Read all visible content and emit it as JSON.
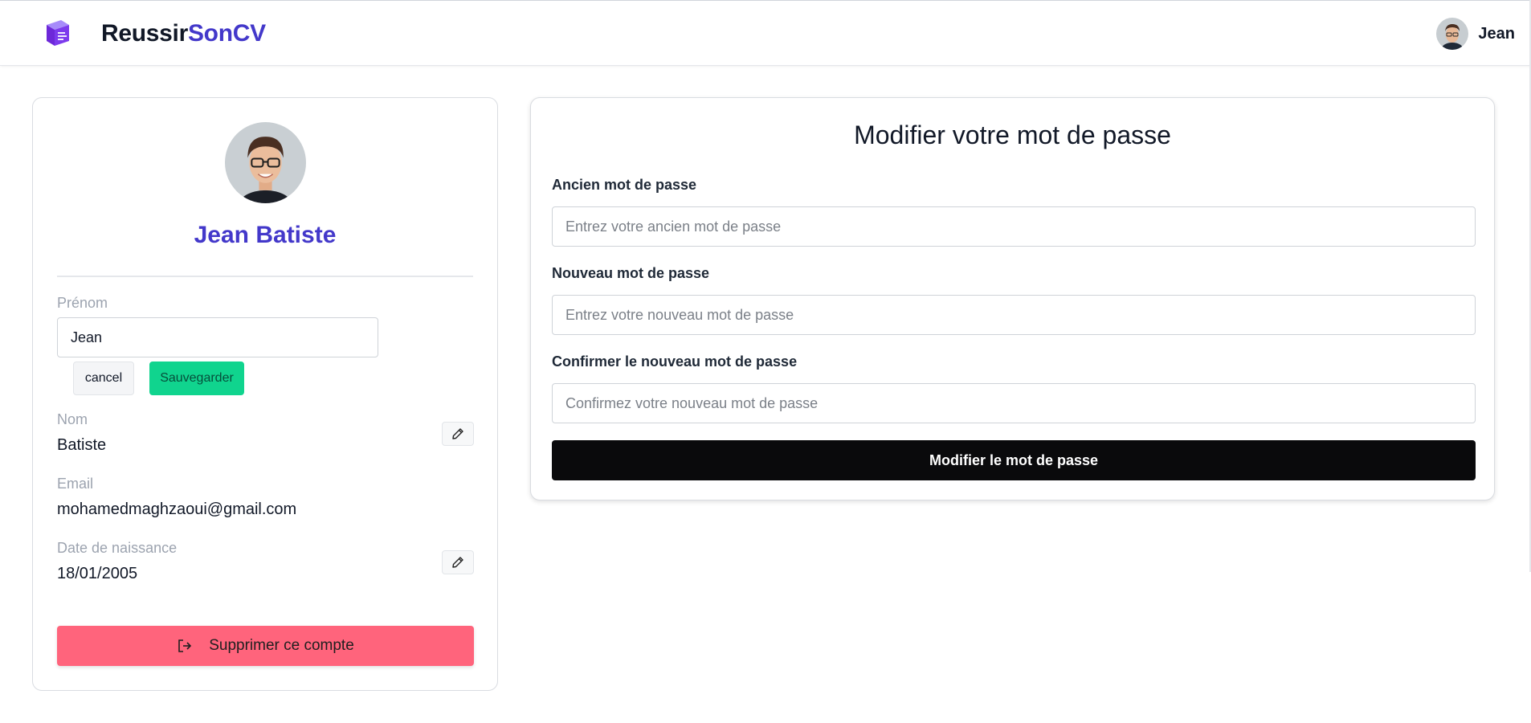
{
  "header": {
    "brand_part1": "Reussir",
    "brand_part2": "SonCV",
    "user_name": "Jean",
    "logo_icon": "cv-document-icon",
    "brand_colors": {
      "dark": "#111827",
      "accent": "#4338ca"
    }
  },
  "profile": {
    "full_name": "Jean Batiste",
    "firstname_label": "Prénom",
    "firstname_value": "Jean",
    "cancel_label": "cancel",
    "save_label": "Sauvegarder",
    "lastname_label": "Nom",
    "lastname_value": "Batiste",
    "email_label": "Email",
    "email_value": "mohamedmaghzaoui@gmail.com",
    "birthdate_label": "Date de naissance",
    "birthdate_value": "18/01/2005",
    "delete_label": "Supprimer ce compte",
    "colors": {
      "save": "#10d48e",
      "delete": "#ff647c"
    }
  },
  "password": {
    "title": "Modifier votre mot de passe",
    "old_label": "Ancien mot de passe",
    "old_placeholder": "Entrez votre ancien mot de passe",
    "new_label": "Nouveau mot de passe",
    "new_placeholder": "Entrez votre nouveau mot de passe",
    "confirm_label": "Confirmer le nouveau mot de passe",
    "confirm_placeholder": "Confirmez votre nouveau mot de passe",
    "submit_label": "Modifier le mot de passe"
  }
}
